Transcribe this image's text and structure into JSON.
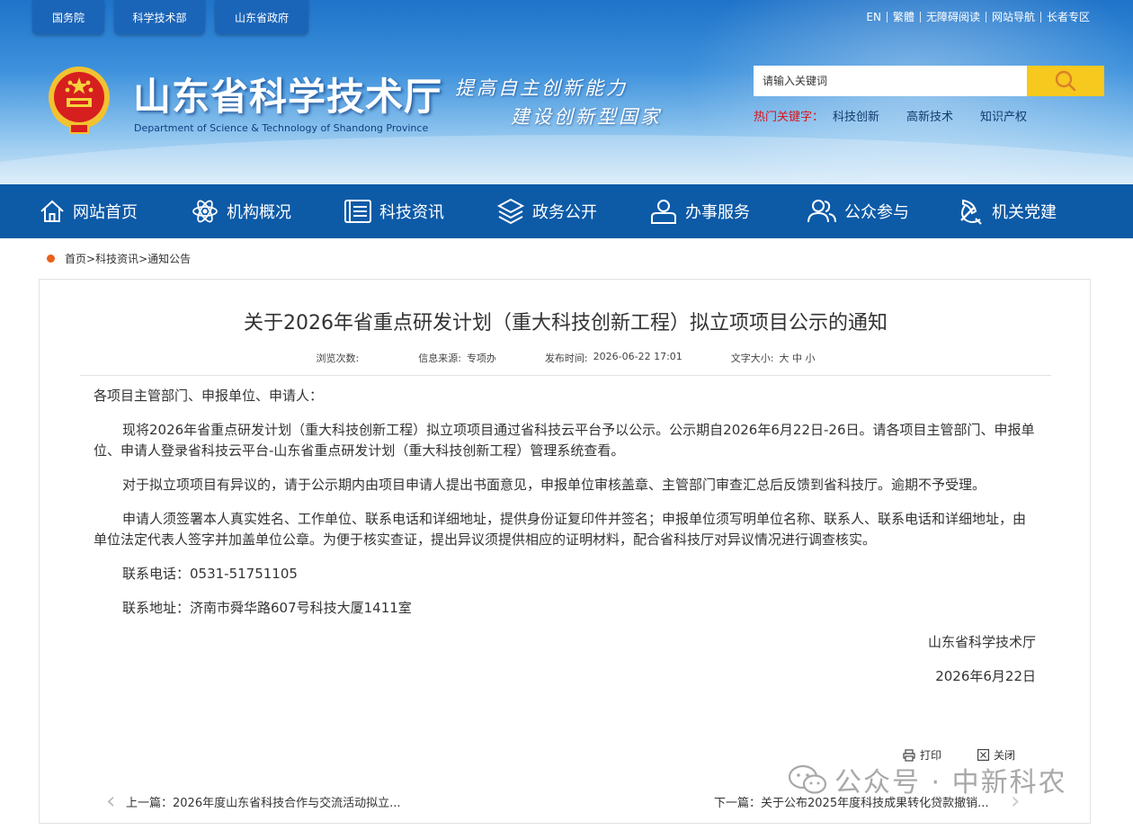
{
  "gov_links": [
    "国务院",
    "科学技术部",
    "山东省政府"
  ],
  "top_links": [
    "EN",
    "繁體",
    "无障碍阅读",
    "网站导航",
    "长者专区"
  ],
  "site": {
    "title": "山东省科学技术厅",
    "subtitle": "Department of Science & Technology of Shandong Province",
    "slogan_line1": "提高自主创新能力",
    "slogan_line2": "建设创新型国家"
  },
  "search": {
    "placeholder": "请输入关键词",
    "hot_label": "热门关键字：",
    "hot_words": [
      "科技创新",
      "高新技术",
      "知识产权"
    ]
  },
  "nav": [
    {
      "label": "网站首页",
      "icon": "home-icon"
    },
    {
      "label": "机构概况",
      "icon": "atom-icon"
    },
    {
      "label": "科技资讯",
      "icon": "news-list-icon"
    },
    {
      "label": "政务公开",
      "icon": "layers-icon"
    },
    {
      "label": "办事服务",
      "icon": "person-service-icon"
    },
    {
      "label": "公众参与",
      "icon": "people-icon"
    },
    {
      "label": "机关党建",
      "icon": "party-emblem-icon"
    }
  ],
  "breadcrumb": [
    "首页",
    ">",
    "科技资讯",
    ">",
    "通知公告"
  ],
  "article": {
    "title": "关于2026年省重点研发计划（重大科技创新工程）拟立项项目公示的通知",
    "meta": {
      "views_label": "浏览次数:",
      "views_value": "",
      "source_label": "信息来源:",
      "source_value": "专项办",
      "date_label": "发布时间:",
      "date_value": "2026-06-22 17:01",
      "font_label": "文字大小:",
      "font_sizes": "大 中 小"
    },
    "salutation": "各项目主管部门、申报单位、申请人：",
    "paragraphs": [
      "现将2026年省重点研发计划（重大科技创新工程）拟立项项目通过省科技云平台予以公示。公示期自2026年6月22日-26日。请各项目主管部门、申报单位、申请人登录省科技云平台-山东省重点研发计划（重大科技创新工程）管理系统查看。",
      "对于拟立项项目有异议的，请于公示期内由项目申请人提出书面意见，申报单位审核盖章、主管部门审查汇总后反馈到省科技厅。逾期不予受理。",
      "申请人须签署本人真实姓名、工作单位、联系电话和详细地址，提供身份证复印件并签名；申报单位须写明单位名称、联系人、联系电话和详细地址，由单位法定代表人签字并加盖单位公章。为便于核实查证，提出异议须提供相应的证明材料，配合省科技厅对异议情况进行调查核实。",
      "联系电话：0531-51751105",
      "联系地址：济南市舜华路607号科技大厦1411室"
    ],
    "signature": "山东省科学技术厅",
    "sign_date": "2026年6月22日"
  },
  "actions": {
    "print": "打印",
    "close": "关闭"
  },
  "prev_next": {
    "prev": "上一篇：2026年度山东省科技合作与交流活动拟立...",
    "next": "下一篇：关于公布2025年度科技成果转化贷款撤销..."
  },
  "watermark": {
    "text": "公众号 · 中新科农"
  },
  "colors": {
    "nav_bg": "#0d5aa7",
    "hot_label": "#d8141b",
    "search_button": "#f7c81d",
    "crumb_dot": "#e8611a"
  }
}
